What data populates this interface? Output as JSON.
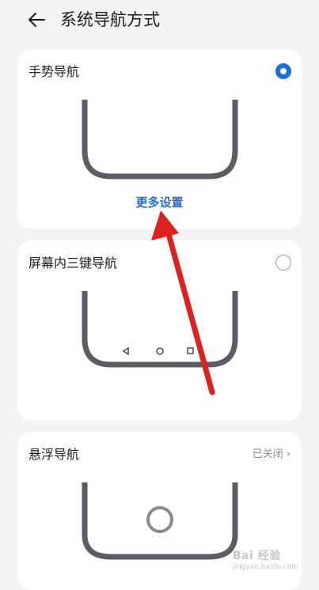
{
  "header": {
    "title": "系统导航方式",
    "back_icon": "back-arrow-icon"
  },
  "accent_color": "#1f6fd6",
  "cards": [
    {
      "label": "手势导航",
      "selected": true,
      "more_link": "更多设置"
    },
    {
      "label": "屏幕内三键导航",
      "selected": false
    },
    {
      "label": "悬浮导航",
      "status": "已关闭"
    }
  ],
  "watermark": {
    "text": "Bai 经验",
    "sub": "jingyan.baidu.com"
  }
}
